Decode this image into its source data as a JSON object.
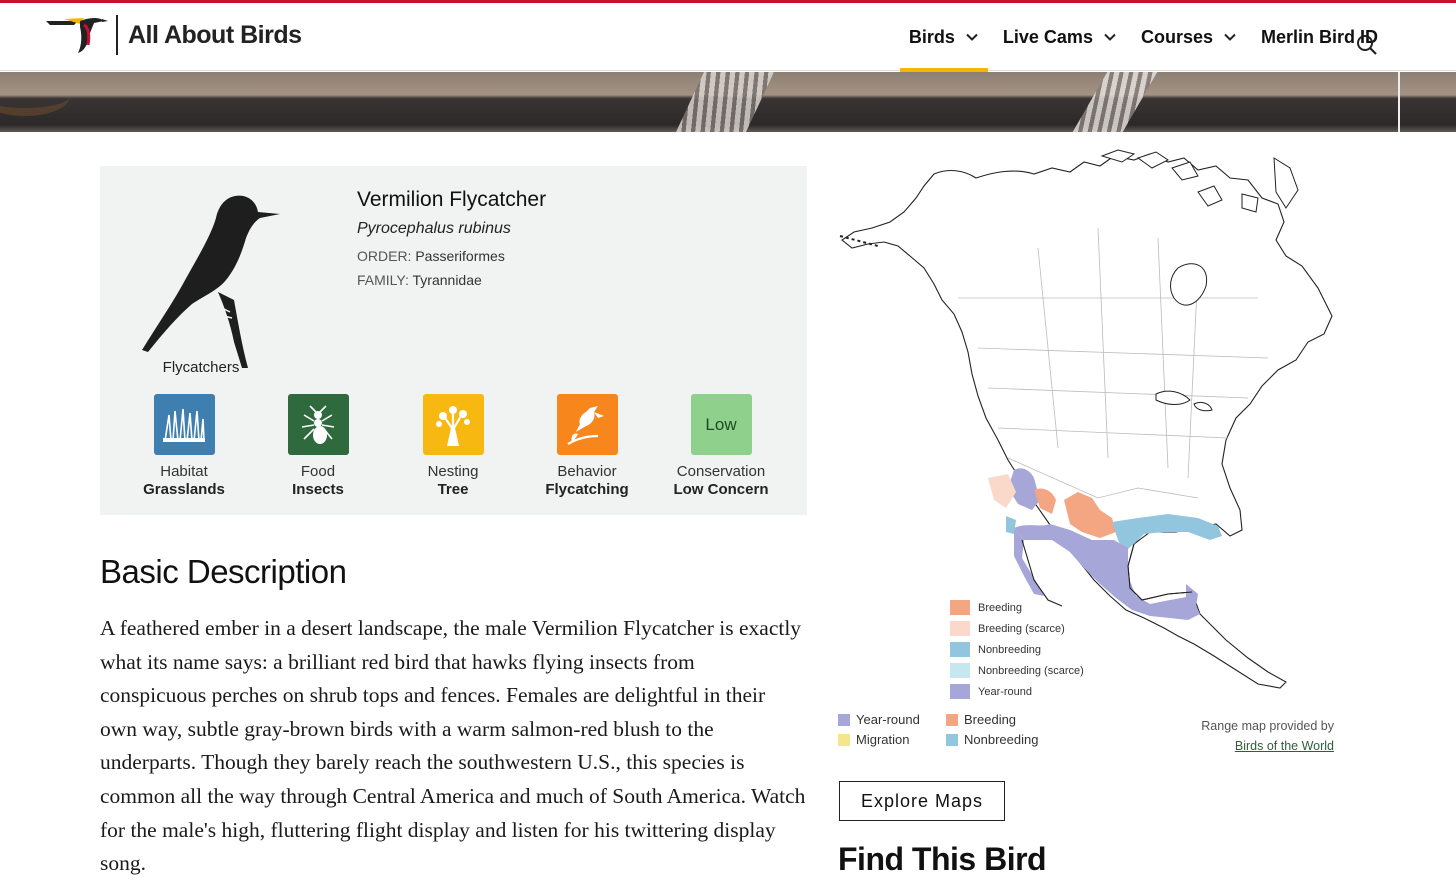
{
  "site": {
    "name": "All About Birds"
  },
  "nav": {
    "items": [
      {
        "label": "Birds",
        "active": true,
        "dropdown": true
      },
      {
        "label": "Live Cams",
        "active": false,
        "dropdown": true
      },
      {
        "label": "Courses",
        "active": false,
        "dropdown": true
      },
      {
        "label": "Merlin Bird ID",
        "active": false,
        "dropdown": false
      }
    ],
    "search_icon": "search-icon",
    "active_color": "#f2b705"
  },
  "species": {
    "common_name": "Vermilion Flycatcher",
    "scientific_name": "Pyrocephalus rubinus",
    "order_key": "ORDER:",
    "order": "Passeriformes",
    "family_key": "FAMILY:",
    "family": "Tyrannidae",
    "group": "Flycatchers"
  },
  "stats": [
    {
      "label": "Habitat",
      "value": "Grasslands",
      "icon": "grass-icon",
      "color": "#3e7fb0"
    },
    {
      "label": "Food",
      "value": "Insects",
      "icon": "insect-icon",
      "color": "#2e6a3e"
    },
    {
      "label": "Nesting",
      "value": "Tree",
      "icon": "tree-icon",
      "color": "#f7b812"
    },
    {
      "label": "Behavior",
      "value": "Flycatching",
      "icon": "flycatching-bird-icon",
      "color": "#f7861c"
    },
    {
      "label": "Conservation",
      "value": "Low Concern",
      "badge": "Low",
      "color": "#8fd08c"
    }
  ],
  "description": {
    "title": "Basic Description",
    "text": "A feathered ember in a desert landscape, the male Vermilion Flycatcher is exactly what its name says: a brilliant red bird that hawks flying insects from conspicuous perches on shrub tops and fences. Females are delightful in their own way, subtle gray-brown birds with a warm salmon-red blush to the underparts. Though they barely reach the southwestern U.S., this species is common all the way through Central America and much of South America. Watch for the male's high, fluttering flight display and listen for his twittering display song."
  },
  "map": {
    "legend": [
      {
        "label": "Breeding",
        "color": "#f4a582"
      },
      {
        "label": "Breeding (scarce)",
        "color": "#fbd9ca"
      },
      {
        "label": "Nonbreeding",
        "color": "#92c5de"
      },
      {
        "label": "Nonbreeding (scarce)",
        "color": "#c6e6f0"
      },
      {
        "label": "Year-round",
        "color": "#a7a6d8"
      }
    ],
    "bottom_legend": [
      {
        "label": "Year-round",
        "color": "#a7a6d8"
      },
      {
        "label": "Migration",
        "color": "#f5e68b"
      },
      {
        "label": "Breeding",
        "color": "#f4a582"
      },
      {
        "label": "Nonbreeding",
        "color": "#92c5de"
      }
    ],
    "credit_text": "Range map provided by",
    "credit_link": "Birds of the World",
    "explore_label": "Explore Maps"
  },
  "find": {
    "title": "Find This Bird"
  }
}
